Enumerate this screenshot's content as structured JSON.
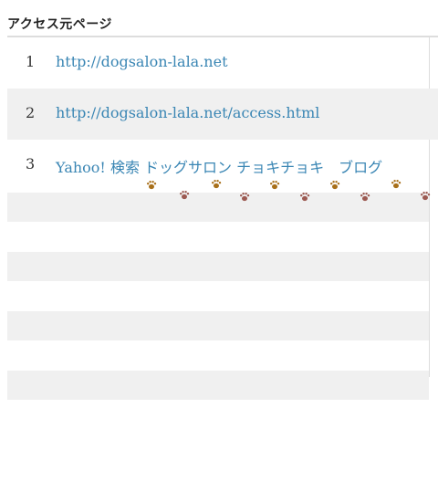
{
  "section": {
    "title": "アクセス元ページ"
  },
  "referrers": [
    {
      "rank": "1",
      "label": "http://dogsalon-lala.net"
    },
    {
      "rank": "2",
      "label": "http://dogsalon-lala.net/access.html"
    },
    {
      "rank": "3",
      "label": "Yahoo! 検索 ドッグサロン チョキチョキ　ブログ"
    }
  ],
  "colors": {
    "link": "#3a86b4",
    "row_shade": "#f0f0f0",
    "paw_gold": "#a8701a",
    "paw_red": "#9c5a52"
  },
  "decoration": {
    "icon": "paw-print-icon"
  }
}
